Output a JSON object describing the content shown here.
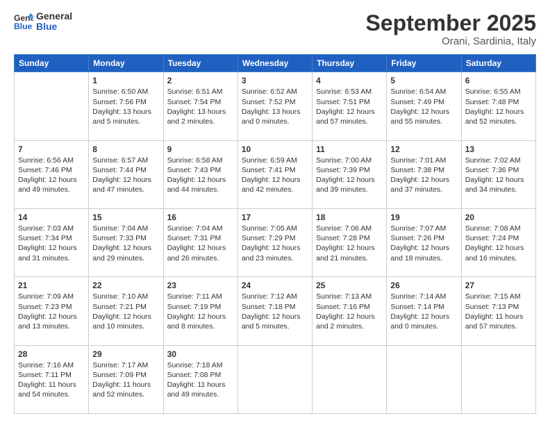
{
  "logo": {
    "line1": "General",
    "line2": "Blue"
  },
  "title": "September 2025",
  "location": "Orani, Sardinia, Italy",
  "days_header": [
    "Sunday",
    "Monday",
    "Tuesday",
    "Wednesday",
    "Thursday",
    "Friday",
    "Saturday"
  ],
  "weeks": [
    [
      {
        "day": "",
        "sunrise": "",
        "sunset": "",
        "daylight": ""
      },
      {
        "day": "1",
        "sunrise": "Sunrise: 6:50 AM",
        "sunset": "Sunset: 7:56 PM",
        "daylight": "Daylight: 13 hours and 5 minutes."
      },
      {
        "day": "2",
        "sunrise": "Sunrise: 6:51 AM",
        "sunset": "Sunset: 7:54 PM",
        "daylight": "Daylight: 13 hours and 2 minutes."
      },
      {
        "day": "3",
        "sunrise": "Sunrise: 6:52 AM",
        "sunset": "Sunset: 7:52 PM",
        "daylight": "Daylight: 13 hours and 0 minutes."
      },
      {
        "day": "4",
        "sunrise": "Sunrise: 6:53 AM",
        "sunset": "Sunset: 7:51 PM",
        "daylight": "Daylight: 12 hours and 57 minutes."
      },
      {
        "day": "5",
        "sunrise": "Sunrise: 6:54 AM",
        "sunset": "Sunset: 7:49 PM",
        "daylight": "Daylight: 12 hours and 55 minutes."
      },
      {
        "day": "6",
        "sunrise": "Sunrise: 6:55 AM",
        "sunset": "Sunset: 7:48 PM",
        "daylight": "Daylight: 12 hours and 52 minutes."
      }
    ],
    [
      {
        "day": "7",
        "sunrise": "Sunrise: 6:56 AM",
        "sunset": "Sunset: 7:46 PM",
        "daylight": "Daylight: 12 hours and 49 minutes."
      },
      {
        "day": "8",
        "sunrise": "Sunrise: 6:57 AM",
        "sunset": "Sunset: 7:44 PM",
        "daylight": "Daylight: 12 hours and 47 minutes."
      },
      {
        "day": "9",
        "sunrise": "Sunrise: 6:58 AM",
        "sunset": "Sunset: 7:43 PM",
        "daylight": "Daylight: 12 hours and 44 minutes."
      },
      {
        "day": "10",
        "sunrise": "Sunrise: 6:59 AM",
        "sunset": "Sunset: 7:41 PM",
        "daylight": "Daylight: 12 hours and 42 minutes."
      },
      {
        "day": "11",
        "sunrise": "Sunrise: 7:00 AM",
        "sunset": "Sunset: 7:39 PM",
        "daylight": "Daylight: 12 hours and 39 minutes."
      },
      {
        "day": "12",
        "sunrise": "Sunrise: 7:01 AM",
        "sunset": "Sunset: 7:38 PM",
        "daylight": "Daylight: 12 hours and 37 minutes."
      },
      {
        "day": "13",
        "sunrise": "Sunrise: 7:02 AM",
        "sunset": "Sunset: 7:36 PM",
        "daylight": "Daylight: 12 hours and 34 minutes."
      }
    ],
    [
      {
        "day": "14",
        "sunrise": "Sunrise: 7:03 AM",
        "sunset": "Sunset: 7:34 PM",
        "daylight": "Daylight: 12 hours and 31 minutes."
      },
      {
        "day": "15",
        "sunrise": "Sunrise: 7:04 AM",
        "sunset": "Sunset: 7:33 PM",
        "daylight": "Daylight: 12 hours and 29 minutes."
      },
      {
        "day": "16",
        "sunrise": "Sunrise: 7:04 AM",
        "sunset": "Sunset: 7:31 PM",
        "daylight": "Daylight: 12 hours and 26 minutes."
      },
      {
        "day": "17",
        "sunrise": "Sunrise: 7:05 AM",
        "sunset": "Sunset: 7:29 PM",
        "daylight": "Daylight: 12 hours and 23 minutes."
      },
      {
        "day": "18",
        "sunrise": "Sunrise: 7:06 AM",
        "sunset": "Sunset: 7:28 PM",
        "daylight": "Daylight: 12 hours and 21 minutes."
      },
      {
        "day": "19",
        "sunrise": "Sunrise: 7:07 AM",
        "sunset": "Sunset: 7:26 PM",
        "daylight": "Daylight: 12 hours and 18 minutes."
      },
      {
        "day": "20",
        "sunrise": "Sunrise: 7:08 AM",
        "sunset": "Sunset: 7:24 PM",
        "daylight": "Daylight: 12 hours and 16 minutes."
      }
    ],
    [
      {
        "day": "21",
        "sunrise": "Sunrise: 7:09 AM",
        "sunset": "Sunset: 7:23 PM",
        "daylight": "Daylight: 12 hours and 13 minutes."
      },
      {
        "day": "22",
        "sunrise": "Sunrise: 7:10 AM",
        "sunset": "Sunset: 7:21 PM",
        "daylight": "Daylight: 12 hours and 10 minutes."
      },
      {
        "day": "23",
        "sunrise": "Sunrise: 7:11 AM",
        "sunset": "Sunset: 7:19 PM",
        "daylight": "Daylight: 12 hours and 8 minutes."
      },
      {
        "day": "24",
        "sunrise": "Sunrise: 7:12 AM",
        "sunset": "Sunset: 7:18 PM",
        "daylight": "Daylight: 12 hours and 5 minutes."
      },
      {
        "day": "25",
        "sunrise": "Sunrise: 7:13 AM",
        "sunset": "Sunset: 7:16 PM",
        "daylight": "Daylight: 12 hours and 2 minutes."
      },
      {
        "day": "26",
        "sunrise": "Sunrise: 7:14 AM",
        "sunset": "Sunset: 7:14 PM",
        "daylight": "Daylight: 12 hours and 0 minutes."
      },
      {
        "day": "27",
        "sunrise": "Sunrise: 7:15 AM",
        "sunset": "Sunset: 7:13 PM",
        "daylight": "Daylight: 11 hours and 57 minutes."
      }
    ],
    [
      {
        "day": "28",
        "sunrise": "Sunrise: 7:16 AM",
        "sunset": "Sunset: 7:11 PM",
        "daylight": "Daylight: 11 hours and 54 minutes."
      },
      {
        "day": "29",
        "sunrise": "Sunrise: 7:17 AM",
        "sunset": "Sunset: 7:09 PM",
        "daylight": "Daylight: 11 hours and 52 minutes."
      },
      {
        "day": "30",
        "sunrise": "Sunrise: 7:18 AM",
        "sunset": "Sunset: 7:08 PM",
        "daylight": "Daylight: 11 hours and 49 minutes."
      },
      {
        "day": "",
        "sunrise": "",
        "sunset": "",
        "daylight": ""
      },
      {
        "day": "",
        "sunrise": "",
        "sunset": "",
        "daylight": ""
      },
      {
        "day": "",
        "sunrise": "",
        "sunset": "",
        "daylight": ""
      },
      {
        "day": "",
        "sunrise": "",
        "sunset": "",
        "daylight": ""
      }
    ]
  ]
}
